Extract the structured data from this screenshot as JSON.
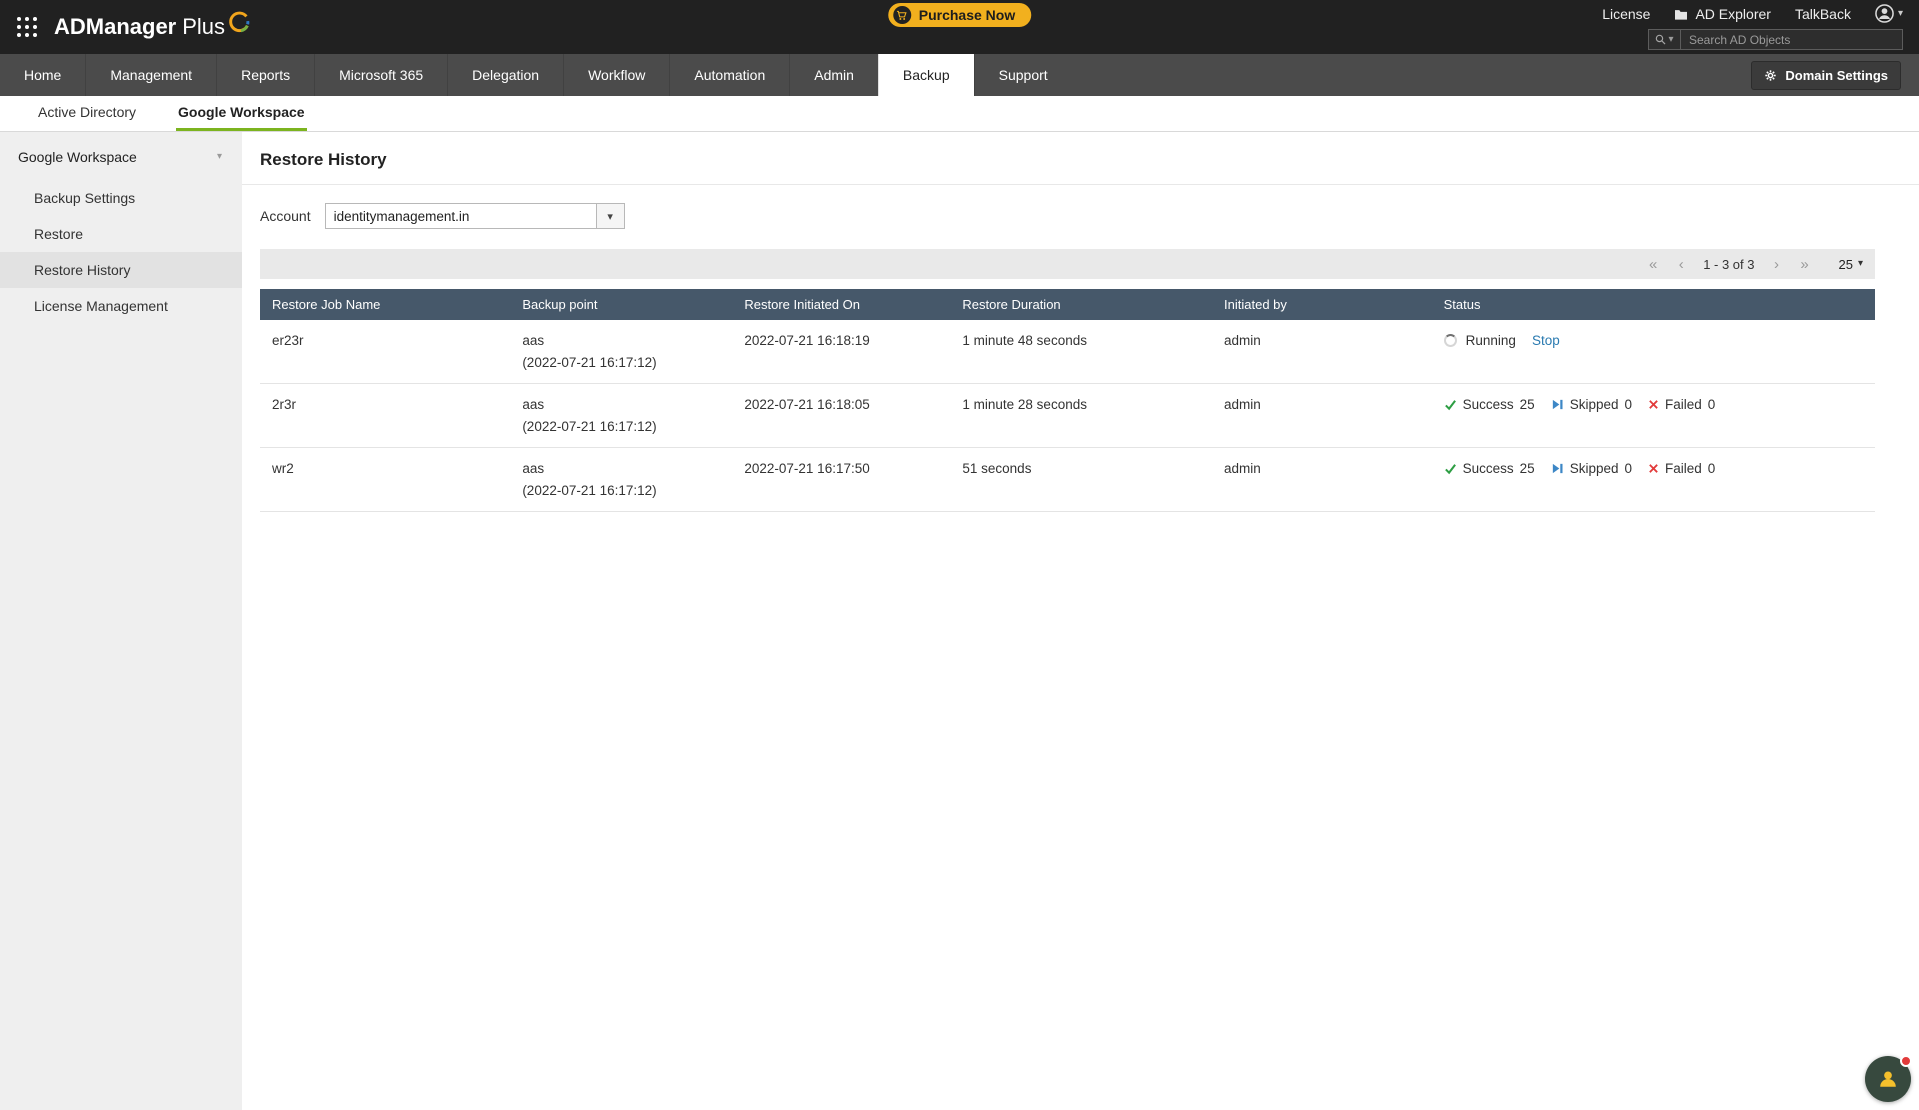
{
  "header": {
    "brand": "ADManager",
    "brand_suffix": "Plus",
    "purchase_now": "Purchase Now",
    "license": "License",
    "ad_explorer": "AD Explorer",
    "talkback": "TalkBack",
    "search_placeholder": "Search AD Objects"
  },
  "nav": {
    "tabs": [
      "Home",
      "Management",
      "Reports",
      "Microsoft 365",
      "Delegation",
      "Workflow",
      "Automation",
      "Admin",
      "Backup",
      "Support"
    ],
    "active_tab": "Backup",
    "domain_settings": "Domain Settings"
  },
  "subtabs": {
    "items": [
      "Active Directory",
      "Google Workspace"
    ],
    "active": "Google Workspace"
  },
  "sidebar": {
    "header": "Google Workspace",
    "items": [
      "Backup Settings",
      "Restore",
      "Restore History",
      "License Management"
    ],
    "active_item": "Restore History"
  },
  "main": {
    "title": "Restore History",
    "account_label": "Account",
    "account_value": "identitymanagement.in",
    "pagination": {
      "range_text": "1 - 3 of 3",
      "page_size": "25"
    },
    "table": {
      "columns": [
        "Restore Job Name",
        "Backup point",
        "Restore Initiated On",
        "Restore Duration",
        "Initiated by",
        "Status"
      ],
      "rows": [
        {
          "job_name": "er23r",
          "backup_point": "aas",
          "backup_point_detail": "(2022-07-21 16:17:12)",
          "initiated_on": "2022-07-21 16:18:19",
          "duration": "1 minute 48 seconds",
          "initiated_by": "admin",
          "status_label": "Running",
          "action": "Stop"
        },
        {
          "job_name": "2r3r",
          "backup_point": "aas",
          "backup_point_detail": "(2022-07-21 16:17:12)",
          "initiated_on": "2022-07-21 16:18:05",
          "duration": "1 minute 28 seconds",
          "initiated_by": "admin",
          "success_label": "Success",
          "success_count": "25",
          "skipped_label": "Skipped",
          "skipped_count": "0",
          "failed_label": "Failed",
          "failed_count": "0"
        },
        {
          "job_name": "wr2",
          "backup_point": "aas",
          "backup_point_detail": "(2022-07-21 16:17:12)",
          "initiated_on": "2022-07-21 16:17:50",
          "duration": "51 seconds",
          "initiated_by": "admin",
          "success_label": "Success",
          "success_count": "25",
          "skipped_label": "Skipped",
          "skipped_count": "0",
          "failed_label": "Failed",
          "failed_count": "0"
        }
      ]
    }
  },
  "icons": {
    "first_page": "«",
    "prev_page": "‹",
    "next_page": "›",
    "last_page": "»",
    "caret_down": "▾",
    "apps": "grid-dots",
    "cart": "shopping-cart",
    "folder": "folder",
    "user": "person-circle",
    "search": "magnifier",
    "gear": "gear",
    "check": "checkmark",
    "skip": "skip-forward",
    "cross": "x-mark",
    "spinner": "loading-spinner",
    "chat": "person-support"
  },
  "colors": {
    "header_bg": "#212121",
    "nav_bg": "#4b4b4b",
    "accent_green": "#7cb41f",
    "purchase_yellow": "#f2b01e",
    "table_header": "#46586a",
    "success_green": "#2e9e44",
    "skipped_blue": "#3d87c6",
    "failed_red": "#e23b3b",
    "link_blue": "#2a7ab0"
  }
}
